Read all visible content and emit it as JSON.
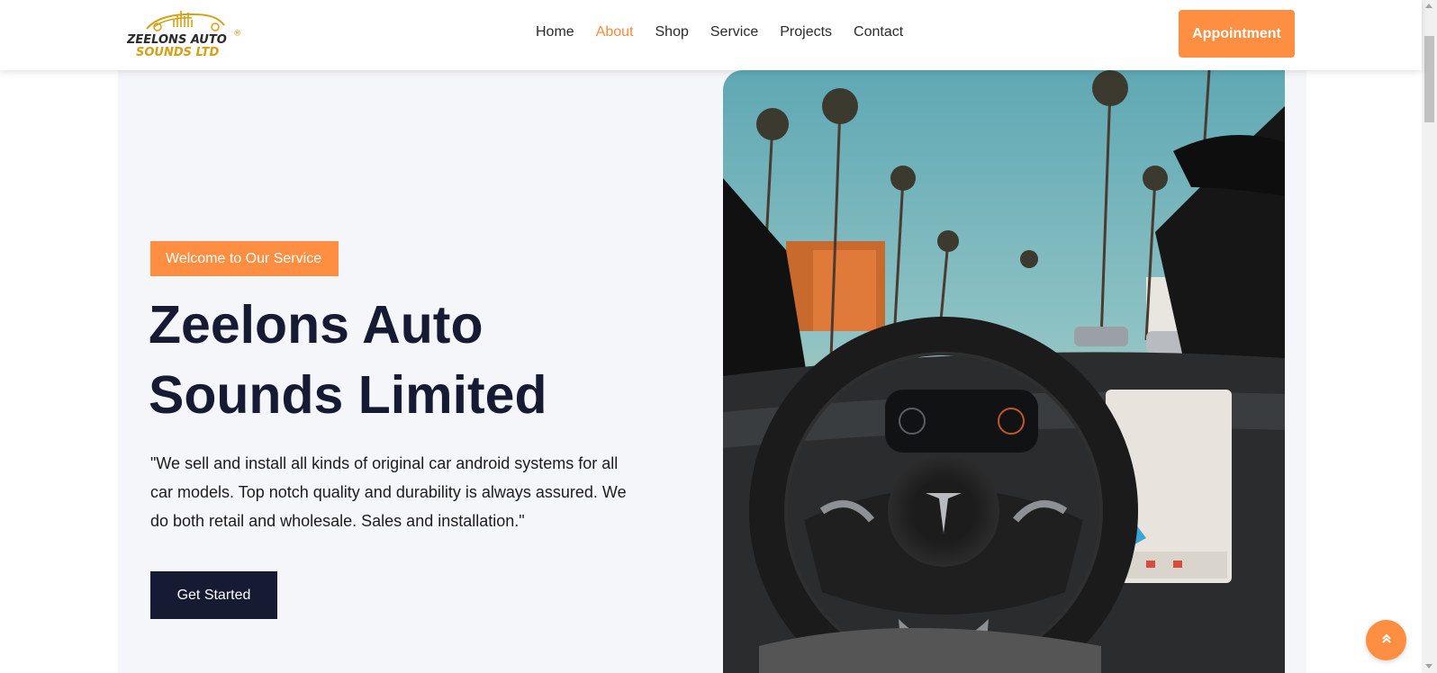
{
  "header": {
    "logo_text_line1": "ZEELONS AUTO",
    "logo_text_line2": "SOUNDS LTD",
    "logo_registered": "®",
    "nav": [
      {
        "label": "Home"
      },
      {
        "label": "About"
      },
      {
        "label": "Shop"
      },
      {
        "label": "Service"
      },
      {
        "label": "Projects"
      },
      {
        "label": "Contact"
      }
    ],
    "active_nav": "About",
    "appointment_label": "Appointment"
  },
  "hero": {
    "badge": "Welcome to Our Service",
    "title_line1": "Zeelons Auto",
    "title_line2": "Sounds Limited",
    "description": "\"We sell and install all kinds of original car android systems for all car models. Top notch quality and durability is always assured. We do both retail and wholesale. Sales and installation.\"",
    "cta_label": "Get Started"
  },
  "back_to_top_icon": "double-chevron-up-icon",
  "colors": {
    "accent": "#fd8e42",
    "dark": "#161a33",
    "hero_bg": "#f5f6fa"
  }
}
